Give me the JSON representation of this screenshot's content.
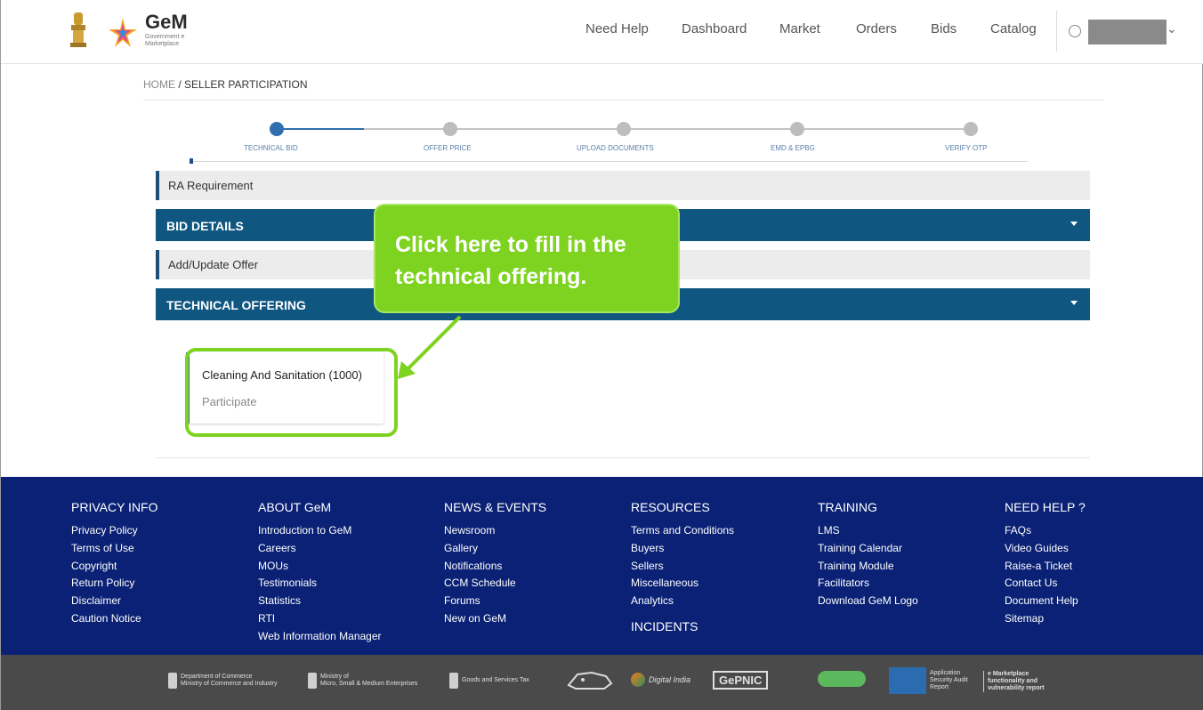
{
  "header": {
    "brand": "GeM",
    "brand_sub": "Government e Marketplace",
    "nav": [
      "Need Help",
      "Dashboard",
      "Market",
      "Orders",
      "Bids",
      "Catalog"
    ]
  },
  "breadcrumb": {
    "home": "HOME",
    "separator": "/",
    "current": "SELLER PARTICIPATION"
  },
  "stepper": {
    "steps": [
      "TECHNICAL BID",
      "OFFER PRICE",
      "UPLOAD DOCUMENTS",
      "EMD & EPBG",
      "VERIFY OTP"
    ],
    "active_index": 0
  },
  "sections": {
    "ra_requirement": "RA Requirement",
    "bid_details": "BID DETAILS",
    "add_update_offer": "Add/Update Offer",
    "technical_offering": "TECHNICAL OFFERING"
  },
  "callout": {
    "text": "Click here to fill in the technical offering."
  },
  "offering_card": {
    "title": "Cleaning And Sanitation (1000)",
    "action": "Participate"
  },
  "footer": {
    "columns": [
      {
        "heading": "PRIVACY INFO",
        "links": [
          "Privacy Policy",
          "Terms of Use",
          "Copyright",
          "Return Policy",
          "Disclaimer",
          "Caution Notice"
        ]
      },
      {
        "heading": "ABOUT GeM",
        "links": [
          "Introduction to GeM",
          "Careers",
          "MOUs",
          "Testimonials",
          "Statistics",
          "RTI",
          "Web Information Manager"
        ]
      },
      {
        "heading": "NEWS & EVENTS",
        "links": [
          "Newsroom",
          "Gallery",
          "Notifications",
          "CCM Schedule",
          "Forums",
          "New on GeM"
        ]
      },
      {
        "heading": "RESOURCES",
        "links": [
          "Terms and Conditions",
          "Buyers",
          "Sellers",
          "Miscellaneous",
          "Analytics"
        ],
        "subheading": "INCIDENTS"
      },
      {
        "heading": "TRAINING",
        "links": [
          "LMS",
          "Training Calendar",
          "Training Module",
          "Facilitators",
          "Download GeM Logo"
        ]
      },
      {
        "heading": "NEED HELP ?",
        "links": [
          "FAQs",
          "Video Guides",
          "Raise-a Ticket",
          "Contact Us",
          "Document Help",
          "Sitemap"
        ]
      }
    ]
  },
  "partners": {
    "dept_commerce": "Department of Commerce\nMinistry of Commerce and Industry",
    "msme": "Ministry of\nMicro, Small & Medium Enterprises",
    "gst": "Goods and Services Tax",
    "digital_india": "Digital India",
    "gepnic": "GePNIC",
    "stqc": "Application Security Audit Report",
    "emarketplace": "e Marketplace functionality and vulnerability report"
  },
  "colors": {
    "accent_green": "#7ed321",
    "section_blue": "#0f5680",
    "footer_blue": "#0a2175",
    "step_active": "#2f6fad"
  }
}
